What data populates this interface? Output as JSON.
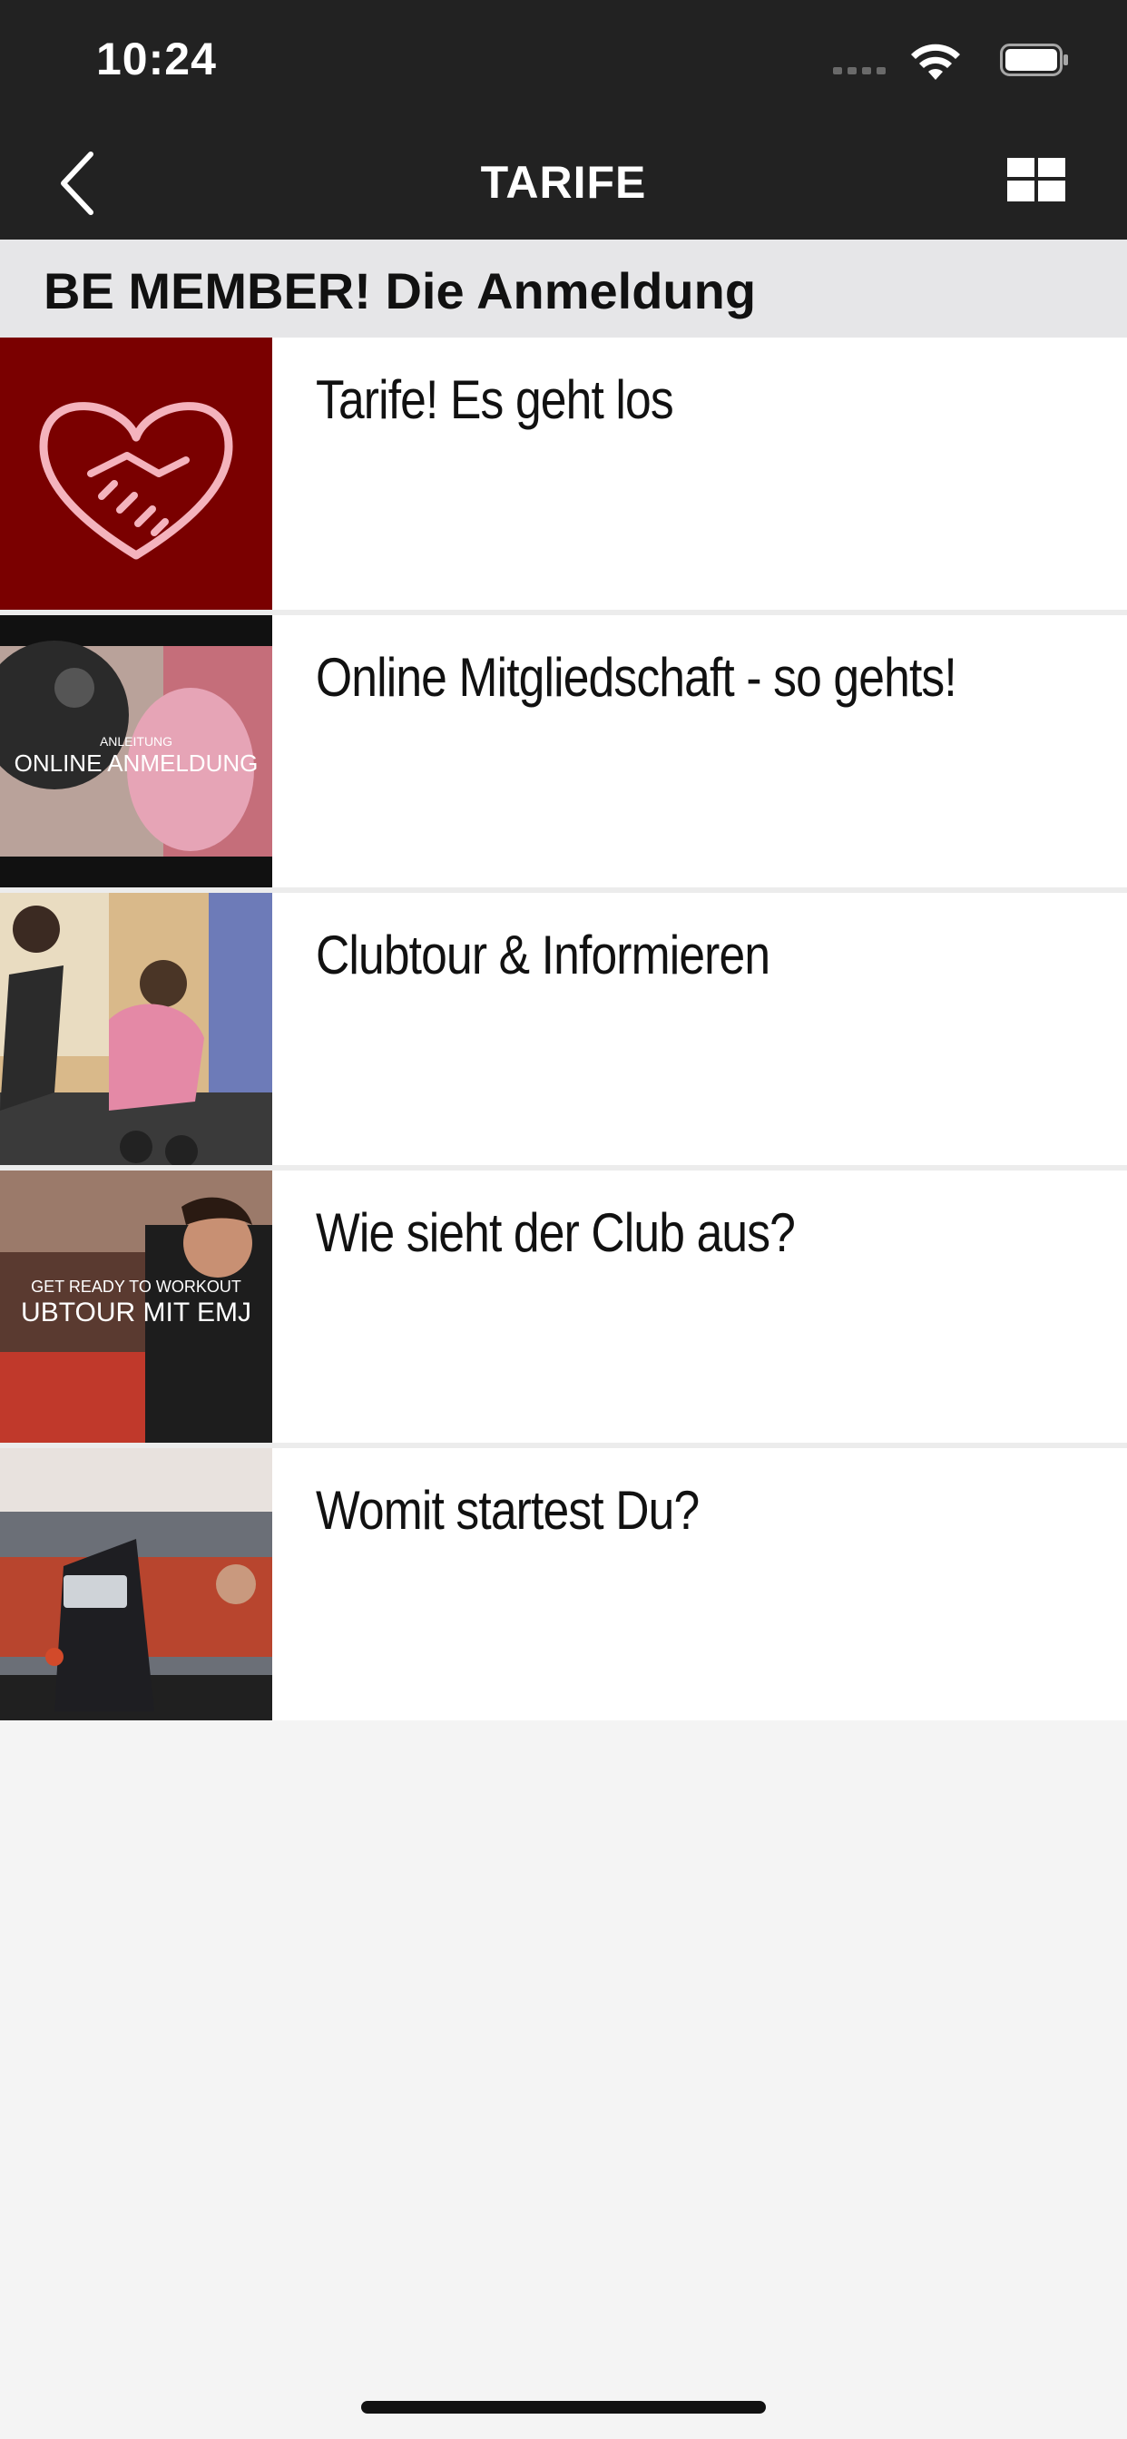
{
  "status_bar": {
    "time": "10:24"
  },
  "nav": {
    "title": "TARIFE"
  },
  "section": {
    "title": "BE MEMBER! Die Anmeldung"
  },
  "items": [
    {
      "title": "Tarife! Es geht los",
      "thumb": "heart-handshake-icon"
    },
    {
      "title": "Online Mitgliedschaft - so gehts!",
      "thumb": "video-thumbnail",
      "overlay_small": "ANLEITUNG",
      "overlay_big": "ONLINE ANMELDUNG"
    },
    {
      "title": "Clubtour & Informieren",
      "thumb": "photo-thumbnail"
    },
    {
      "title": "Wie sieht der Club aus?",
      "thumb": "video-thumbnail",
      "overlay_small": "GET READY TO WORKOUT",
      "overlay_big": "UBTOUR MIT EMJ"
    },
    {
      "title": "Womit startest Du?",
      "thumb": "photo-thumbnail"
    }
  ],
  "colors": {
    "bar": "#222222",
    "accent": "#7a0000",
    "section_bg": "#e6e6e8",
    "page_bg": "#f4f4f4"
  }
}
